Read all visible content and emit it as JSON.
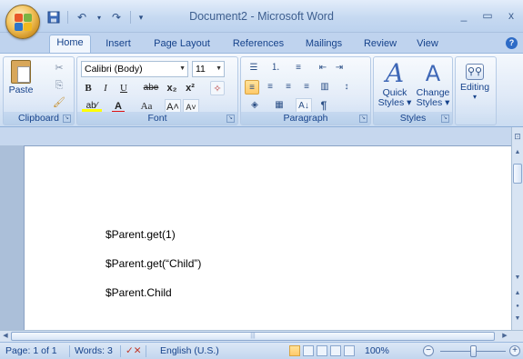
{
  "window": {
    "title": "Document2 - Microsoft Word",
    "minimize": "_",
    "maximize": "▭",
    "close": "x"
  },
  "qat": {
    "save_icon": "save-icon",
    "undo": "↶",
    "undo_arrow": "▾",
    "redo": "↷",
    "customize": "▾"
  },
  "tabs": [
    "Home",
    "Insert",
    "Page Layout",
    "References",
    "Mailings",
    "Review",
    "View"
  ],
  "active_tab": "Home",
  "help": "?",
  "ribbon": {
    "clipboard": {
      "label": "Clipboard",
      "paste": "Paste",
      "cut": "✂",
      "copy": "⎘",
      "format_painter": "🖌"
    },
    "font": {
      "label": "Font",
      "font_name": "Calibri (Body)",
      "font_size": "11",
      "bold": "B",
      "italic": "I",
      "underline": "U",
      "strikethrough": "abe",
      "subscript": "x₂",
      "superscript": "x²",
      "clear_format": "✧",
      "highlight": "ab⁄",
      "font_color": "A",
      "change_case": "Aa",
      "grow": "A˄",
      "shrink": "A˅"
    },
    "paragraph": {
      "label": "Paragraph",
      "bullets": "☰",
      "numbering": "⒈",
      "multilevel": "≡",
      "decrease_indent": "⇤",
      "increase_indent": "⇥",
      "align_left": "≡",
      "center": "≡",
      "align_right": "≡",
      "justify": "≡",
      "columns": "▥",
      "line_spacing": "↕",
      "shading": "◈",
      "borders": "▦",
      "sort": "A↓",
      "show_marks": "¶"
    },
    "styles": {
      "label": "Styles",
      "quick_styles_line1": "Quick",
      "quick_styles_line2": "Styles ▾",
      "change_styles_line1": "Change",
      "change_styles_line2": "Styles ▾"
    },
    "editing": {
      "label": "Editing",
      "arrow": "▾"
    }
  },
  "document": {
    "lines": [
      "$Parent.get(1)",
      "$Parent.get(“Child”)",
      "$Parent.Child"
    ]
  },
  "scrollbar": {
    "up": "▲",
    "down": "▼",
    "left": "◀",
    "right": "▶",
    "prev_page": "▲",
    "select_browse": "●",
    "next_page": "▼",
    "grip": "|||"
  },
  "status": {
    "page": "Page: 1 of 1",
    "words": "Words: 3",
    "language": "English (U.S.)",
    "zoom": "100%",
    "zoom_out": "−",
    "zoom_in": "+"
  },
  "colors": {
    "ribbon_bg": "#dfe9f7",
    "text_blue": "#15428b",
    "active_align": "#ffc96a"
  }
}
